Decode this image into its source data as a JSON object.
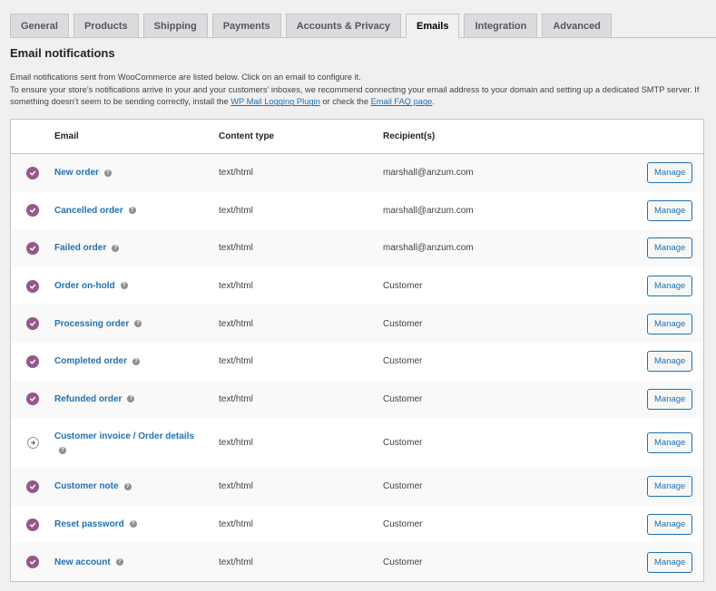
{
  "tabs": [
    {
      "label": "General",
      "active": false
    },
    {
      "label": "Products",
      "active": false
    },
    {
      "label": "Shipping",
      "active": false
    },
    {
      "label": "Payments",
      "active": false
    },
    {
      "label": "Accounts & Privacy",
      "active": false
    },
    {
      "label": "Emails",
      "active": true
    },
    {
      "label": "Integration",
      "active": false
    },
    {
      "label": "Advanced",
      "active": false
    }
  ],
  "page": {
    "title": "Email notifications",
    "intro_line1": "Email notifications sent from WooCommerce are listed below. Click on an email to configure it.",
    "intro_line2_pre": "To ensure your store’s notifications arrive in your and your customers’ inboxes, we recommend connecting your email address to your domain and setting up a dedicated SMTP server. If something doesn’t seem to be sending correctly, install the ",
    "link1": "WP Mail Logging Plugin",
    "intro_line2_mid": " or check the ",
    "link2": "Email FAQ page",
    "intro_line2_post": "."
  },
  "table": {
    "headers": {
      "email": "Email",
      "content_type": "Content type",
      "recipients": "Recipient(s)"
    },
    "manage_label": "Manage",
    "help_glyph": "?",
    "rows": [
      {
        "name": "New order",
        "content_type": "text/html",
        "recipient": "marshall@anzum.com",
        "status": "enabled"
      },
      {
        "name": "Cancelled order",
        "content_type": "text/html",
        "recipient": "marshall@anzum.com",
        "status": "enabled"
      },
      {
        "name": "Failed order",
        "content_type": "text/html",
        "recipient": "marshall@anzum.com",
        "status": "enabled"
      },
      {
        "name": "Order on-hold",
        "content_type": "text/html",
        "recipient": "Customer",
        "status": "enabled"
      },
      {
        "name": "Processing order",
        "content_type": "text/html",
        "recipient": "Customer",
        "status": "enabled"
      },
      {
        "name": "Completed order",
        "content_type": "text/html",
        "recipient": "Customer",
        "status": "enabled"
      },
      {
        "name": "Refunded order",
        "content_type": "text/html",
        "recipient": "Customer",
        "status": "enabled"
      },
      {
        "name": "Customer invoice / Order details",
        "content_type": "text/html",
        "recipient": "Customer",
        "status": "manual"
      },
      {
        "name": "Customer note",
        "content_type": "text/html",
        "recipient": "Customer",
        "status": "enabled"
      },
      {
        "name": "Reset password",
        "content_type": "text/html",
        "recipient": "Customer",
        "status": "enabled"
      },
      {
        "name": "New account",
        "content_type": "text/html",
        "recipient": "Customer",
        "status": "enabled"
      }
    ]
  },
  "colors": {
    "accent": "#2271b1",
    "enabled_status": "#96588a"
  }
}
